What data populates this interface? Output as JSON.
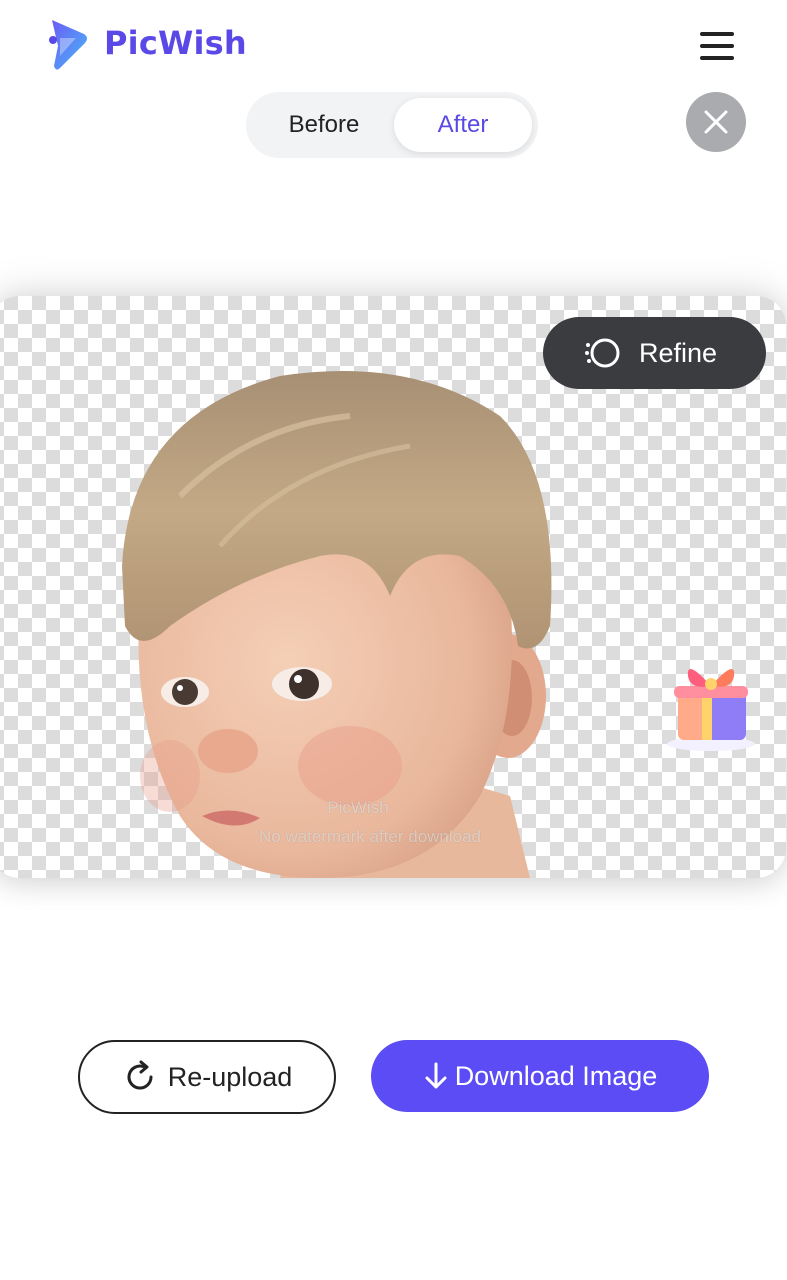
{
  "header": {
    "brand_name": "PicWish",
    "brand_color": "#5a49e6",
    "menu_icon": "hamburger-menu-icon"
  },
  "view_toggle": {
    "options": [
      "Before",
      "After"
    ],
    "selected": "After"
  },
  "close_icon": "close-icon",
  "preview": {
    "refine_label": "Refine",
    "refine_icon": "refine-icon",
    "watermark_line1": "PicWish",
    "watermark_line2": "No watermark after download",
    "gift_icon": "gift-icon",
    "background": "transparent-checkerboard"
  },
  "actions": {
    "reupload_label": "Re-upload",
    "reupload_icon": "refresh-icon",
    "download_label": "Download Image",
    "download_icon": "download-arrow-icon",
    "download_color": "#5b4cf5"
  }
}
